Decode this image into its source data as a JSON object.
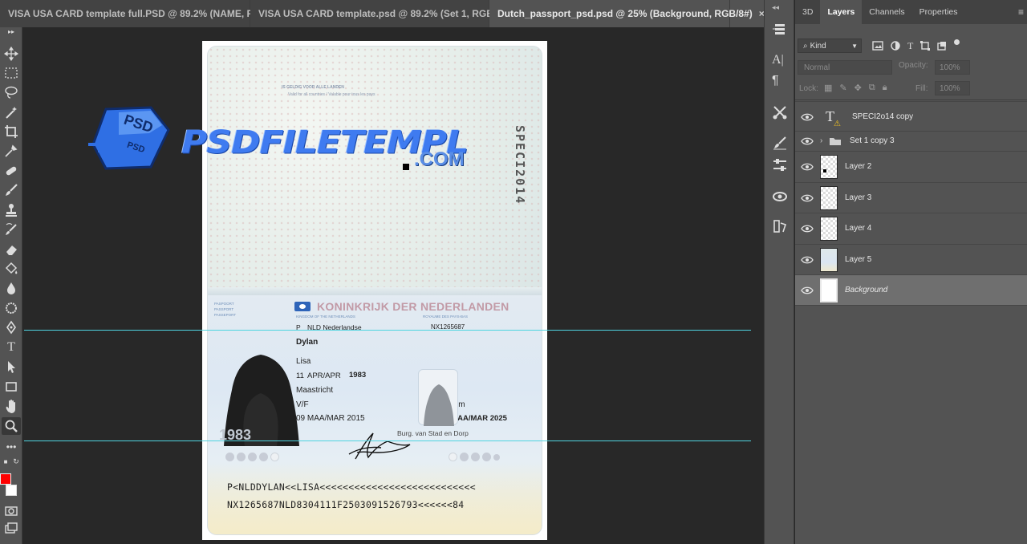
{
  "tabs": [
    {
      "label": "VISA USA CARD template full.PSD @ 89.2% (NAME, RG...",
      "close": "×",
      "active": false
    },
    {
      "label": "VISA USA CARD template.psd @ 89.2% (Set 1, RGB/...",
      "close": "×",
      "active": false
    },
    {
      "label": "Dutch_passport_psd.psd @ 25% (Background, RGB/8#)",
      "close": "×",
      "active": true
    }
  ],
  "toolbar": {
    "tools": [
      "move-tool",
      "marquee-tool",
      "lasso-tool",
      "magic-wand-tool",
      "crop-tool",
      "eyedropper-tool",
      "healing-brush-tool",
      "brush-tool",
      "clone-stamp-tool",
      "history-brush-tool",
      "eraser-tool",
      "paint-bucket-tool",
      "blur-tool",
      "dodge-tool",
      "pen-tool",
      "type-tool",
      "path-selection-tool",
      "rectangle-tool",
      "hand-tool",
      "zoom-tool",
      "more-tools"
    ],
    "foreground_color": "#ff0000",
    "background_color": "#ffffff"
  },
  "passport": {
    "top_text1": "IS GELDIG VOOR ALLE LANDEN",
    "top_text2": "Valid for all countries / Valable pour tous les pays",
    "spec_number": "SPECI2014",
    "kingdom": "KONINKRIJK DER NEDERLANDEN",
    "doc_type_labels": [
      "PASPOORT",
      "PASSPORT",
      "PASSEPORT"
    ],
    "kingdom_en": "KINGDOM OF THE NETHERLANDS",
    "kingdom_fr": "ROYAUME DES PAYS-BAS",
    "type": "P",
    "nationality": "NLD Nederlandse",
    "doc_number": "NX1265687",
    "surname": "Dylan",
    "given_names": "Lisa",
    "birth_day": "11",
    "birth_month": "APR/APR",
    "birth_year": "1983",
    "birth_place": "Maastricht",
    "sex": "V/F",
    "height": "1,75  m",
    "issue_date": "09 MAA/MAR 2015",
    "expiry_date": "09 MAA/MAR 2025",
    "authority": "Burg. van Stad en Dorp",
    "photo_ghost_text": "1983",
    "mrz_line1": "P<NLDDYLAN<<LISA<<<<<<<<<<<<<<<<<<<<<<<<<<<",
    "mrz_line2": "NX1265687NLD8304111F2503091526793<<<<<<84"
  },
  "watermark": {
    "badge_text_top": "PSD",
    "badge_text_bottom": "PSD",
    "brand": "PSDFILETEMPL",
    "brand_suffix": ".COM"
  },
  "panel": {
    "tabs": [
      "3D",
      "Layers",
      "Channels",
      "Properties"
    ],
    "active_tab": "Layers",
    "kind_label": "Kind",
    "blend_mode": "Normal",
    "opacity_label": "Opacity:",
    "opacity_value": "100%",
    "lock_label": "Lock:",
    "fill_label": "Fill:",
    "fill_value": "100%",
    "layers": [
      {
        "name": "SPECI2o14 copy",
        "kind": "text"
      },
      {
        "name": "Set 1 copy 3",
        "kind": "group"
      },
      {
        "name": "Layer 2",
        "kind": "pixel"
      },
      {
        "name": "Layer 3",
        "kind": "pixel"
      },
      {
        "name": "Layer 4",
        "kind": "pixel"
      },
      {
        "name": "Layer 5",
        "kind": "pixel"
      },
      {
        "name": "Background",
        "kind": "background",
        "selected": true
      }
    ]
  },
  "colors": {
    "guide": "#4fd4e0",
    "panel_bg": "#535353",
    "canvas_bg": "#282828",
    "watermark_blue": "#3f7bf0"
  }
}
